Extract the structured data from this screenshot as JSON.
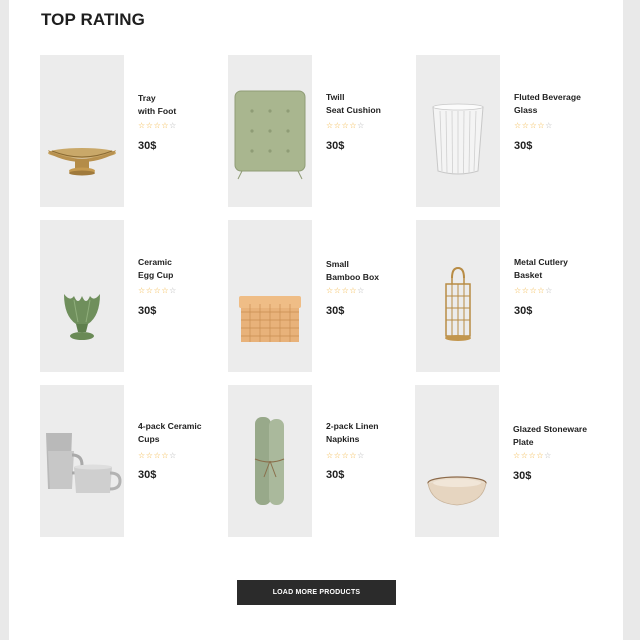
{
  "section": {
    "title": "TOP RATING"
  },
  "colors": {
    "accent_star": "#f2b84b",
    "button_bg": "#2b2b2b",
    "thumb_bg": "#ececec"
  },
  "products": [
    {
      "name": "Tray\nwith Foot",
      "price": "30$",
      "rating": 0,
      "stars_max": 5,
      "icon": "gold-footed-tray"
    },
    {
      "name": "Twill\nSeat Cushion",
      "price": "30$",
      "rating": 0,
      "stars_max": 5,
      "icon": "green-seat-cushion"
    },
    {
      "name": "Fluted Beverage\nGlass",
      "price": "30$",
      "rating": 0,
      "stars_max": 5,
      "icon": "fluted-glass"
    },
    {
      "name": "Ceramic\nEgg Cup",
      "price": "30$",
      "rating": 0,
      "stars_max": 5,
      "icon": "green-egg-cup"
    },
    {
      "name": "Small\nBamboo Box",
      "price": "30$",
      "rating": 0,
      "stars_max": 5,
      "icon": "bamboo-box"
    },
    {
      "name": "Metal Cutlery\nBasket",
      "price": "30$",
      "rating": 0,
      "stars_max": 5,
      "icon": "gold-cutlery-basket"
    },
    {
      "name": "4-pack Ceramic\nCups",
      "price": "30$",
      "rating": 0,
      "stars_max": 5,
      "icon": "stacked-grey-cups"
    },
    {
      "name": "2-pack Linen\nNapkins",
      "price": "30$",
      "rating": 0,
      "stars_max": 5,
      "icon": "rolled-linen-napkins"
    },
    {
      "name": "Glazed Stoneware\nPlate",
      "price": "30$",
      "rating": 0,
      "stars_max": 5,
      "icon": "stoneware-bowl"
    }
  ],
  "load_more": {
    "label": "LOAD MORE PRODUCTS"
  }
}
